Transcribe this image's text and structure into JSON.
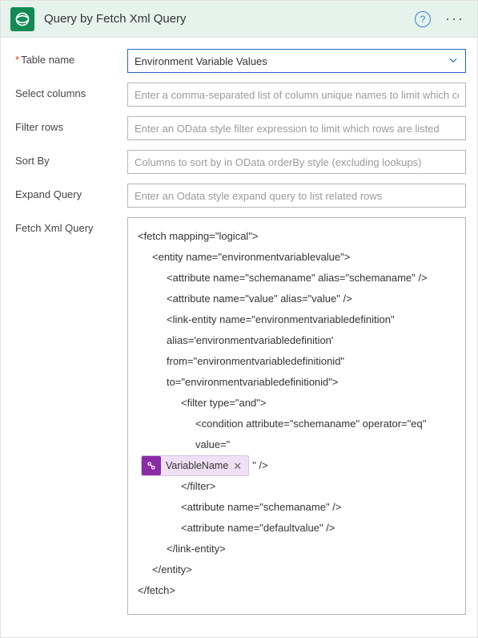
{
  "header": {
    "title": "Query by Fetch Xml Query"
  },
  "fields": {
    "tableName": {
      "label": "Table name",
      "value": "Environment Variable Values"
    },
    "selectColumns": {
      "label": "Select columns",
      "placeholder": "Enter a comma-separated list of column unique names to limit which columns a"
    },
    "filterRows": {
      "label": "Filter rows",
      "placeholder": "Enter an OData style filter expression to limit which rows are listed"
    },
    "sortBy": {
      "label": "Sort By",
      "placeholder": "Columns to sort by in OData orderBy style (excluding lookups)"
    },
    "expandQuery": {
      "label": "Expand Query",
      "placeholder": "Enter an Odata style expand query to list related rows"
    },
    "fetchXml": {
      "label": "Fetch Xml Query"
    }
  },
  "fetchXml": {
    "lines": {
      "l1": "<fetch mapping=\"logical\">",
      "l2": "<entity name=\"environmentvariablevalue\">",
      "l3": "<attribute name=\"schemaname\" alias=\"schemaname\" />",
      "l4": "<attribute name=\"value\" alias=\"value\" />",
      "l5": "<link-entity name=\"environmentvariabledefinition\" alias='environmentvariabledefinition'",
      "l6": "from=\"environmentvariabledefinitionid\" to=\"environmentvariabledefinitionid\">",
      "l7": "<filter type=\"and\">",
      "l8a": "<condition attribute=\"schemaname\" operator=\"eq\" value=\"",
      "l8b": "\" />",
      "l9": "</filter>",
      "l10": "<attribute name=\"schemaname\" />",
      "l11": "<attribute name=\"defaultvalue\" />",
      "l12": "</link-entity>",
      "l13": "</entity>",
      "l14": "</fetch>"
    },
    "token": {
      "label": "VariableName"
    }
  }
}
